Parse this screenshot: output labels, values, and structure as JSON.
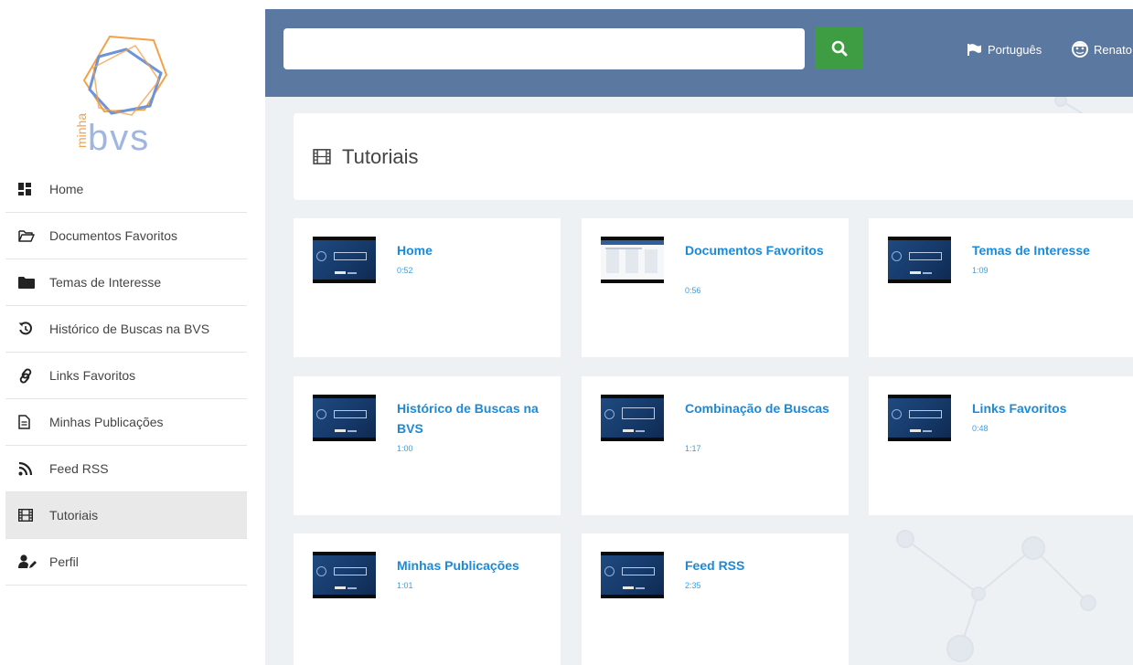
{
  "sidebar": {
    "logo_small": "minha",
    "logo_big": "bvs",
    "items": [
      {
        "label": "Home",
        "icon": "dashboard-icon",
        "name": "sidebar-item-home"
      },
      {
        "label": "Documentos Favoritos",
        "icon": "folder-open-icon",
        "name": "sidebar-item-documentos-favoritos"
      },
      {
        "label": "Temas de Interesse",
        "icon": "folder-icon",
        "name": "sidebar-item-temas-de-interesse"
      },
      {
        "label": "Histórico de Buscas na BVS",
        "icon": "history-icon",
        "name": "sidebar-item-historico"
      },
      {
        "label": "Links Favoritos",
        "icon": "link-icon",
        "name": "sidebar-item-links-favoritos"
      },
      {
        "label": "Minhas Publicações",
        "icon": "document-icon",
        "name": "sidebar-item-minhas-publicacoes"
      },
      {
        "label": "Feed RSS",
        "icon": "rss-icon",
        "name": "sidebar-item-feed-rss"
      },
      {
        "label": "Tutoriais",
        "icon": "film-icon",
        "name": "sidebar-item-tutoriais",
        "active": true
      },
      {
        "label": "Perfil",
        "icon": "user-edit-icon",
        "name": "sidebar-item-perfil"
      }
    ]
  },
  "header": {
    "search": {
      "value": "",
      "placeholder": ""
    },
    "language": "Português",
    "user": "Renato"
  },
  "page": {
    "title": "Tutoriais"
  },
  "tutorials": [
    {
      "title": "Home",
      "duration": "0:52"
    },
    {
      "title": "Documentos Favoritos",
      "duration": "0:56"
    },
    {
      "title": "Temas de Interesse",
      "duration": "1:09"
    },
    {
      "title": "Histórico de Buscas na BVS",
      "duration": "1:00"
    },
    {
      "title": "Combinação de Buscas",
      "duration": "1:17"
    },
    {
      "title": "Links Favoritos",
      "duration": "0:48"
    },
    {
      "title": "Minhas Publicações",
      "duration": "1:01"
    },
    {
      "title": "Feed RSS",
      "duration": "2:35"
    }
  ],
  "colors": {
    "header": "#5a78a0",
    "search_button": "#3e9d42",
    "link": "#1b8ad8",
    "active_item": "#e9e9e9",
    "logo_orange": "#f2a24a",
    "logo_blue": "#6d93d8"
  }
}
